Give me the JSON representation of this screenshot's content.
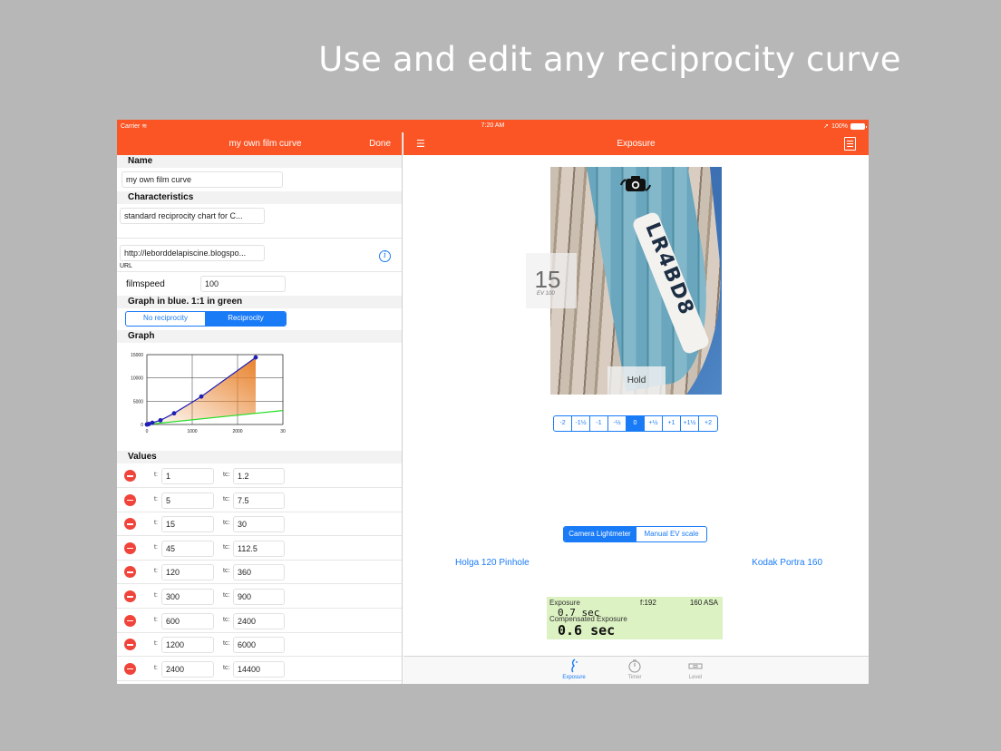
{
  "headline": "Use and edit any reciprocity curve",
  "status": {
    "carrier": "Carrier",
    "time": "7:20 AM",
    "battery": "100%"
  },
  "left": {
    "nav": {
      "title": "my own film curve",
      "done": "Done"
    },
    "name": {
      "header": "Name",
      "value": "my own film curve"
    },
    "characteristics": {
      "header": "Characteristics",
      "value": "standard reciprocity chart for C..."
    },
    "url": {
      "value": "http://leborddelapiscine.blogspo...",
      "label": "URL"
    },
    "filmspeed": {
      "label": "filmspeed",
      "value": "100"
    },
    "graph_mode": {
      "header": "Graph in blue. 1:1 in green",
      "options": [
        "No reciprocity",
        "Reciprocity"
      ],
      "selected": 1
    },
    "graph": {
      "header": "Graph"
    },
    "values_header": "Values",
    "values": [
      {
        "t_label": "t:",
        "t": "1",
        "tc_label": "tc:",
        "tc": "1.2"
      },
      {
        "t_label": "t:",
        "t": "5",
        "tc_label": "tc:",
        "tc": "7.5"
      },
      {
        "t_label": "t:",
        "t": "15",
        "tc_label": "tc:",
        "tc": "30"
      },
      {
        "t_label": "t:",
        "t": "45",
        "tc_label": "tc:",
        "tc": "112.5"
      },
      {
        "t_label": "t:",
        "t": "120",
        "tc_label": "tc:",
        "tc": "360"
      },
      {
        "t_label": "t:",
        "t": "300",
        "tc_label": "tc:",
        "tc": "900"
      },
      {
        "t_label": "t:",
        "t": "600",
        "tc_label": "tc:",
        "tc": "2400"
      },
      {
        "t_label": "t:",
        "t": "1200",
        "tc_label": "tc:",
        "tc": "6000"
      },
      {
        "t_label": "t:",
        "t": "2400",
        "tc_label": "tc:",
        "tc": "14400"
      }
    ]
  },
  "chart_data": {
    "type": "line",
    "x": [
      1,
      5,
      15,
      45,
      120,
      300,
      600,
      1200,
      2400
    ],
    "series": [
      {
        "values": [
          1.2,
          7.5,
          30,
          112.5,
          360,
          900,
          2400,
          6000,
          14400
        ],
        "color": "#1f1fb4"
      },
      {
        "values": [
          1,
          5,
          15,
          45,
          120,
          300,
          600,
          1200,
          2400
        ],
        "color": "#22dd22"
      }
    ],
    "x_ticks": [
      "0",
      "1000",
      "2000",
      "30"
    ],
    "y_ticks": [
      "0",
      "5000",
      "10000",
      "15000"
    ],
    "xlim": [
      0,
      3000
    ],
    "ylim": [
      0,
      15000
    ],
    "fill_color": "#e8822c",
    "grid": true
  },
  "right": {
    "nav": {
      "title": "Exposure"
    },
    "ev": {
      "value": "15",
      "sub": "EV 100"
    },
    "hold": "Hold",
    "hull_text": "LR4BD8",
    "ev_steps": [
      "-2",
      "-1½",
      "-1",
      "-½",
      "0",
      "+½",
      "+1",
      "+1½",
      "+2"
    ],
    "ev_selected": 4,
    "meter_modes": [
      "Camera Lightmeter",
      "Manual EV scale"
    ],
    "meter_selected": 0,
    "camera": "Holga 120 Pinhole",
    "film": "Kodak Portra 160",
    "readout": {
      "exposure_label": "Exposure",
      "fstop": "f:192",
      "asa": "160 ASA",
      "exposure": "0.7 sec",
      "compensated_label": "Compensated Exposure",
      "compensated": "0.6 sec"
    },
    "tabs": [
      {
        "label": "Exposure",
        "icon": "exposure-icon",
        "active": true
      },
      {
        "label": "Timer",
        "icon": "stopwatch-icon",
        "active": false
      },
      {
        "label": "Level",
        "icon": "level-icon",
        "active": false
      }
    ]
  },
  "colors": {
    "accent": "#fb5525",
    "tint": "#1a7bf7",
    "delete": "#f0443b",
    "readout_bg": "#dcf2c2"
  }
}
